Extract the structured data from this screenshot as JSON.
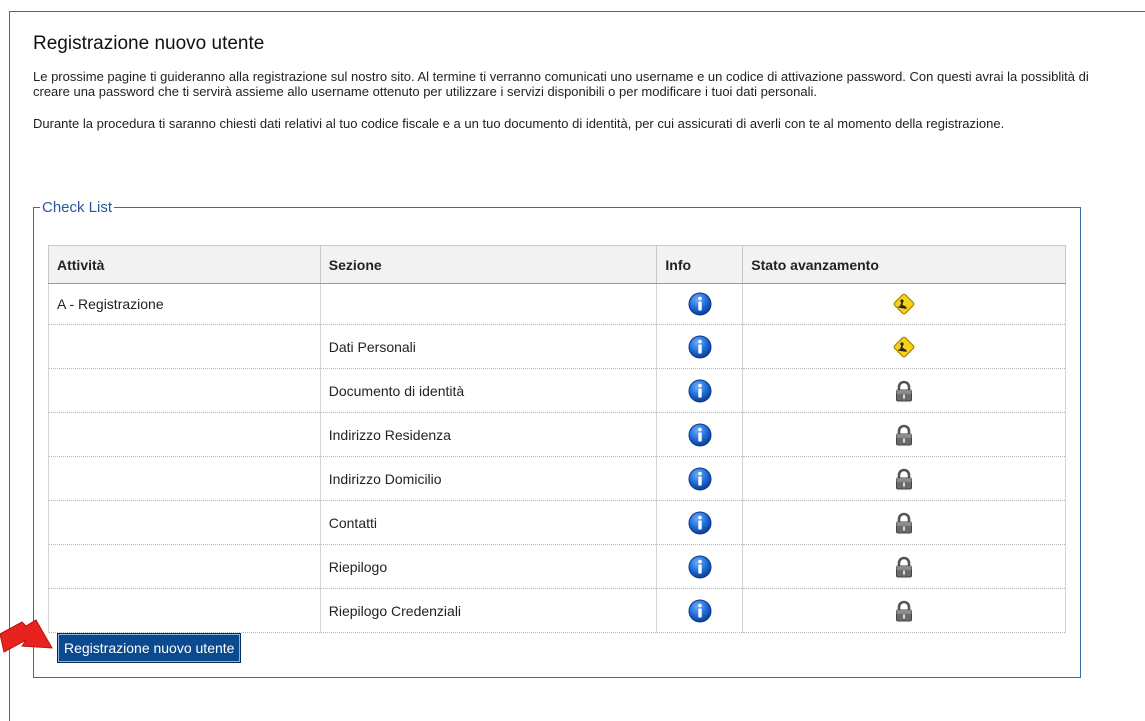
{
  "page": {
    "title": "Registrazione nuovo utente",
    "intro_p1": "Le prossime pagine ti guideranno alla registrazione sul nostro sito. Al termine ti verranno comunicati uno username e un codice di attivazione password. Con questi avrai la possiblità di creare una password che ti servirà assieme allo username ottenuto per utilizzare i servizi disponibili o per modificare i tuoi dati personali.",
    "intro_p2": "Durante la procedura ti saranno chiesti dati relativi al tuo codice fiscale e a un tuo documento di identità, per cui assicurati di averli con te al momento della registrazione."
  },
  "checklist": {
    "legend": "Check List",
    "headers": {
      "attivita": "Attività",
      "sezione": "Sezione",
      "info": "Info",
      "stato": "Stato avanzamento"
    },
    "rows": [
      {
        "attivita": "A - Registrazione",
        "sezione": "",
        "info_icon": "info-icon",
        "status": "in-progress"
      },
      {
        "attivita": "",
        "sezione": "Dati Personali",
        "info_icon": "info-icon",
        "status": "in-progress"
      },
      {
        "attivita": "",
        "sezione": "Documento di identità",
        "info_icon": "info-icon",
        "status": "locked"
      },
      {
        "attivita": "",
        "sezione": "Indirizzo Residenza",
        "info_icon": "info-icon",
        "status": "locked"
      },
      {
        "attivita": "",
        "sezione": "Indirizzo Domicilio",
        "info_icon": "info-icon",
        "status": "locked"
      },
      {
        "attivita": "",
        "sezione": "Contatti",
        "info_icon": "info-icon",
        "status": "locked"
      },
      {
        "attivita": "",
        "sezione": "Riepilogo",
        "info_icon": "info-icon",
        "status": "locked"
      },
      {
        "attivita": "",
        "sezione": "Riepilogo Credenziali",
        "info_icon": "info-icon",
        "status": "locked"
      }
    ]
  },
  "actions": {
    "register_label": "Registrazione nuovo utente"
  },
  "colors": {
    "accent": "#3c6aa4",
    "button_bg": "#0b4a8f",
    "arrow": "#e8231f",
    "info_blue": "#1d6ad6",
    "warning_yellow": "#f6d21a"
  }
}
